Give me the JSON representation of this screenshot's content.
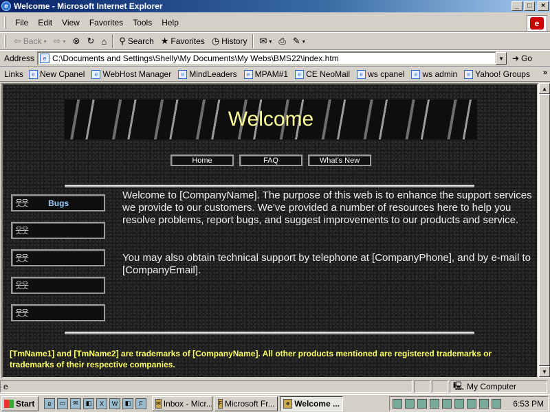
{
  "window": {
    "title": "Welcome - Microsoft Internet Explorer",
    "min": "_",
    "max": "□",
    "close": "×"
  },
  "menu": [
    "File",
    "Edit",
    "View",
    "Favorites",
    "Tools",
    "Help"
  ],
  "toolbar": {
    "back": "Back",
    "search": "Search",
    "favorites": "Favorites",
    "history": "History"
  },
  "address": {
    "label": "Address",
    "url": "C:\\Documents and Settings\\Shelly\\My Documents\\My Webs\\BMS22\\index.htm",
    "go": "Go"
  },
  "links": {
    "label": "Links",
    "items": [
      "New Cpanel",
      "WebHost Manager",
      "MindLeaders",
      "MPAM#1",
      "CE NeoMail",
      "ws cpanel",
      "ws admin",
      "Yahoo! Groups"
    ]
  },
  "page": {
    "banner_title": "Welcome",
    "nav": [
      "Home",
      "FAQ",
      "What's New"
    ],
    "side_buttons": [
      "Bugs",
      "",
      "",
      "",
      ""
    ],
    "para1": "Welcome to [CompanyName]. The purpose of this web is to enhance the support services we provide to our customers. We've provided a number of resources here to help you resolve problems, report bugs, and suggest improvements to our products and service.",
    "para2": "You may also obtain technical support by telephone at [CompanyPhone], and by e-mail to [CompanyEmail].",
    "legal": "[TmName1] and [TmName2] are trademarks of [CompanyName]. All other products mentioned are registered trademarks or trademarks of their respective companies."
  },
  "status": {
    "zone": "My Computer"
  },
  "taskbar": {
    "start": "Start",
    "tasks": [
      "Inbox - Micr...",
      "Microsoft Fr...",
      "Welcome ..."
    ],
    "clock": "6:53 PM"
  }
}
